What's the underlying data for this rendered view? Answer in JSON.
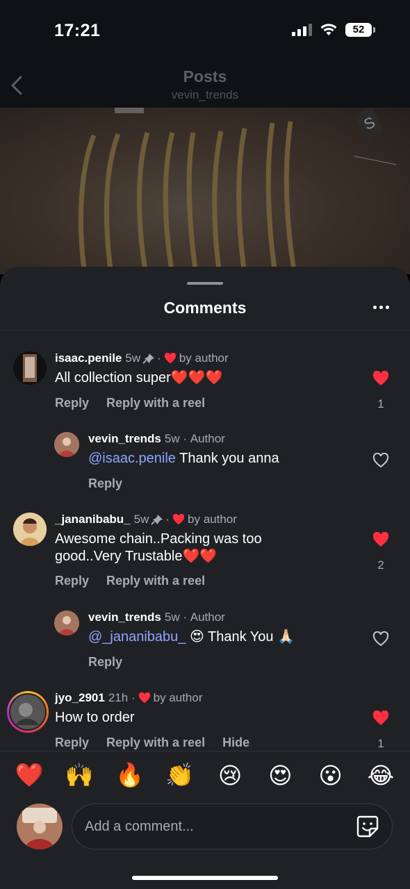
{
  "status_bar": {
    "time": "17:21",
    "battery": "52"
  },
  "header": {
    "title": "Posts",
    "subtitle": "vevin_trends"
  },
  "sheet": {
    "title": "Comments"
  },
  "comments": [
    {
      "username": "isaac.penile",
      "age": "5w",
      "liked_by_author": "by author",
      "text": "All collection super❤️❤️❤️",
      "reply_label": "Reply",
      "reply_reel_label": "Reply with a reel",
      "like_count": "1"
    },
    {
      "username": "vevin_trends",
      "age": "5w",
      "role": "Author",
      "mention": "@isaac.penile",
      "text": " Thank you anna",
      "reply_label": "Reply"
    },
    {
      "username": "_jananibabu_",
      "age": "5w",
      "liked_by_author": "by author",
      "text_line1": "Awesome chain..Packing was too",
      "text_line2": "good..Very Trustable❤️❤️",
      "reply_label": "Reply",
      "reply_reel_label": "Reply with a reel",
      "like_count": "2"
    },
    {
      "username": "vevin_trends",
      "age": "5w",
      "role": "Author",
      "mention": "@_jananibabu_",
      "text": " 😍 Thank You 🙏🏻",
      "reply_label": "Reply"
    },
    {
      "username": "jyo_2901",
      "age": "21h",
      "liked_by_author": "by author",
      "text": "How to order",
      "reply_label": "Reply",
      "reply_reel_label": "Reply with a reel",
      "hide_label": "Hide",
      "like_count": "1"
    }
  ],
  "emoji_bar": [
    "❤️",
    "🙌",
    "🔥",
    "👏",
    "😢",
    "😍",
    "😮",
    "😂"
  ],
  "input": {
    "placeholder": "Add a comment..."
  },
  "colors": {
    "like_red": "#ff3040",
    "mention_blue": "#8ea6ff",
    "sheet_bg": "#202125"
  },
  "icons": [
    "back-chevron-icon",
    "more-dots-icon",
    "pin-icon",
    "heart-icon",
    "heart-outline-icon",
    "sticker-icon"
  ]
}
